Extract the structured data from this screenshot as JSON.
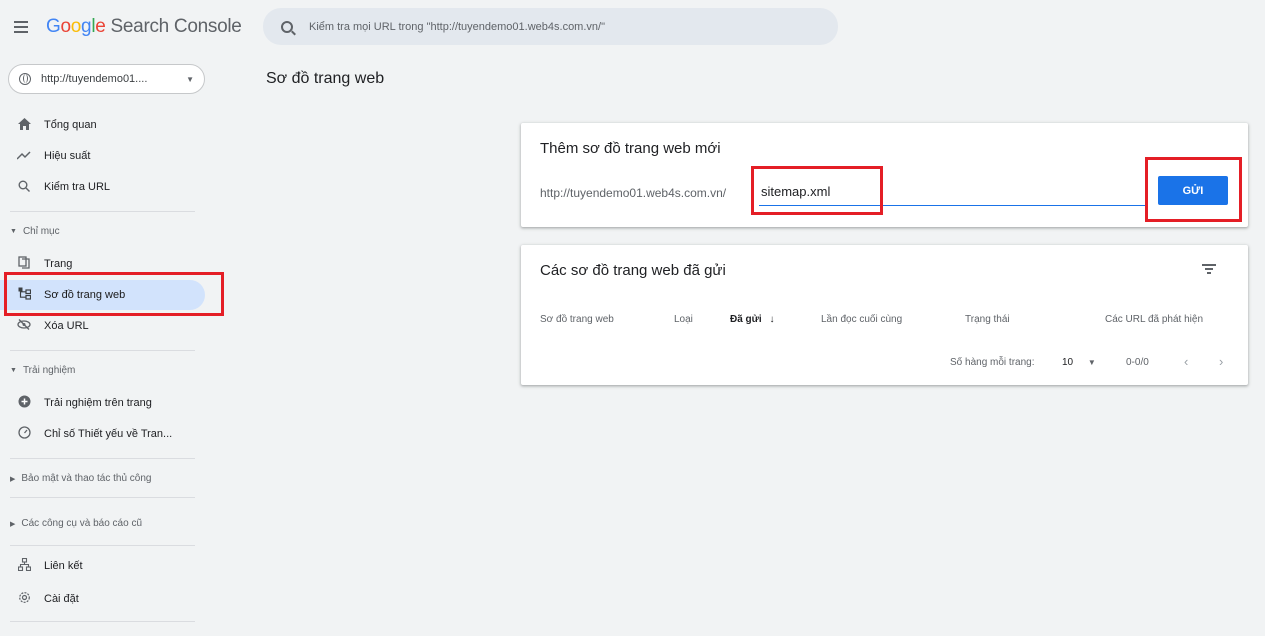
{
  "app": {
    "logo_letters": [
      "G",
      "o",
      "o",
      "g",
      "l",
      "e"
    ],
    "logo_rest": "Search Console",
    "property": "http://tuyendemo01...."
  },
  "search": {
    "placeholder": "Kiểm tra mọi URL trong \"http://tuyendemo01.web4s.com.vn/\""
  },
  "sidebar": {
    "top_items": [
      {
        "label": "Tổng quan",
        "icon": "home-icon"
      },
      {
        "label": "Hiệu suất",
        "icon": "trending-up-icon"
      },
      {
        "label": "Kiểm tra URL",
        "icon": "search-icon"
      }
    ],
    "index_section": "Chỉ mục",
    "index_items": [
      {
        "label": "Trang",
        "icon": "pages-icon"
      },
      {
        "label": "Sơ đồ trang web",
        "icon": "sitemap-icon"
      },
      {
        "label": "Xóa URL",
        "icon": "eye-off-icon"
      }
    ],
    "experience_section": "Trải nghiệm",
    "experience_items": [
      {
        "label": "Trải nghiệm trên trang",
        "icon": "plus-circle-icon"
      },
      {
        "label": "Chỉ số Thiết yếu về Tran...",
        "icon": "gauge-icon"
      }
    ],
    "security_section": "Bảo mật và thao tác thủ công",
    "legacy_section": "Các công cụ và báo cáo cũ",
    "bottom_items": [
      {
        "label": "Liên kết",
        "icon": "links-icon"
      },
      {
        "label": "Cài đặt",
        "icon": "gear-icon"
      }
    ]
  },
  "page": {
    "title": "Sơ đồ trang web"
  },
  "add_sitemap": {
    "title": "Thêm sơ đồ trang web mới",
    "prefix": "http://tuyendemo01.web4s.com.vn/",
    "input_value": "sitemap.xml",
    "submit_label": "GỬI"
  },
  "submitted": {
    "title": "Các sơ đồ trang web đã gửi",
    "columns": [
      "Sơ đồ trang web",
      "Loại",
      "Đã gửi",
      "Lần đọc cuối cùng",
      "Trạng thái",
      "Các URL đã phát hiện"
    ],
    "sort_arrow": "↓",
    "rows_per_page_label": "Số hàng mỗi trang:",
    "rows_per_page_value": "10",
    "range": "0-0/0"
  },
  "colors": {
    "accent": "#1a73e8",
    "highlight": "#e41e26",
    "active_nav": "#d2e3fc"
  }
}
